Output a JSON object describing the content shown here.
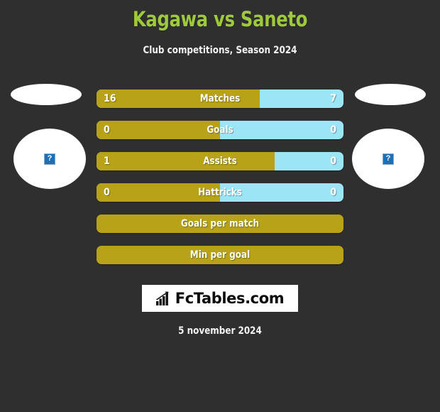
{
  "header": {
    "title": "Kagawa vs Saneto",
    "subtitle": "Club competitions, Season 2024",
    "title_color": "#9fc93c",
    "subtitle_color": "#f2f2f2"
  },
  "theme": {
    "background": "#2f2f2f",
    "home_color": "#b8a318",
    "away_color": "#9ce5f7",
    "text_color": "#ffffff"
  },
  "players": {
    "home": {
      "photo_status": "broken-image",
      "photo_glyph": "?"
    },
    "away": {
      "photo_status": "broken-image",
      "photo_glyph": "?"
    }
  },
  "chart_data": {
    "type": "bar",
    "title": "Kagawa vs Saneto",
    "subtitle": "Club competitions, Season 2024",
    "orientation": "horizontal-diverging",
    "categories": [
      "Matches",
      "Goals",
      "Assists",
      "Hattricks",
      "Goals per match",
      "Min per goal"
    ],
    "series": [
      {
        "name": "Kagawa",
        "color": "#b8a318",
        "values": [
          "16",
          "0",
          "1",
          "0",
          "",
          ""
        ]
      },
      {
        "name": "Saneto",
        "color": "#9ce5f7",
        "values": [
          "7",
          "0",
          "0",
          "0",
          "",
          ""
        ]
      }
    ],
    "legend": "none",
    "grid": false
  },
  "bars": [
    {
      "label": "Matches",
      "left_value": "16",
      "right_value": "7",
      "fill_percent": 66,
      "single": false
    },
    {
      "label": "Goals",
      "left_value": "0",
      "right_value": "0",
      "fill_percent": 50,
      "single": false
    },
    {
      "label": "Assists",
      "left_value": "1",
      "right_value": "0",
      "fill_percent": 72,
      "single": false
    },
    {
      "label": "Hattricks",
      "left_value": "0",
      "right_value": "0",
      "fill_percent": 50,
      "single": false
    },
    {
      "label": "Goals per match",
      "left_value": "",
      "right_value": "",
      "fill_percent": 100,
      "single": true
    },
    {
      "label": "Min per goal",
      "left_value": "",
      "right_value": "",
      "fill_percent": 100,
      "single": true
    }
  ],
  "logo": {
    "text": "FcTables.com",
    "icon": "bar-chart-icon"
  },
  "footer": {
    "date": "5 november 2024"
  }
}
